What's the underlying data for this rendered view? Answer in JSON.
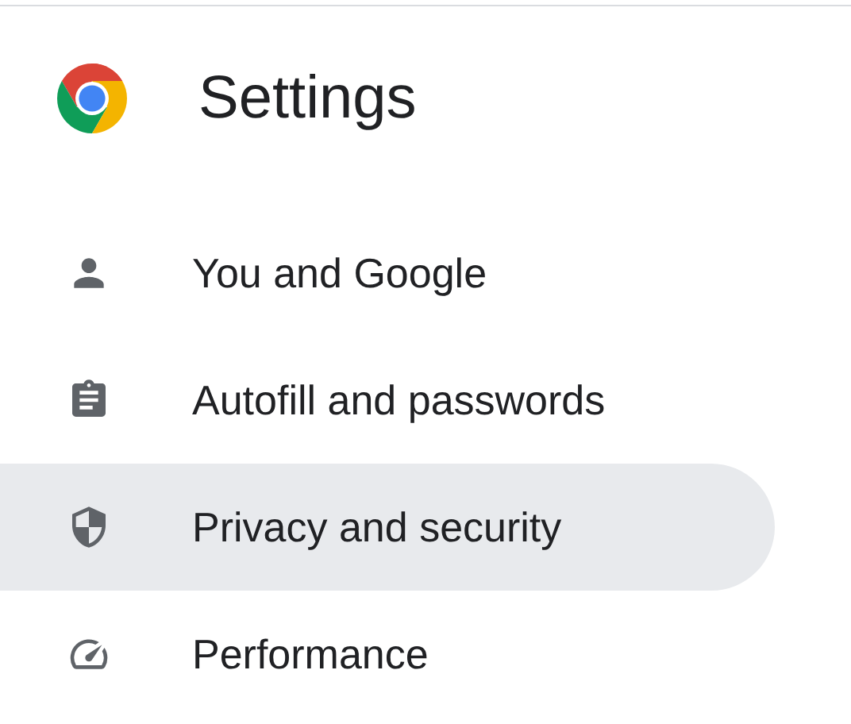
{
  "header": {
    "title": "Settings"
  },
  "menu": [
    {
      "label": "You and Google",
      "selected": false
    },
    {
      "label": "Autofill and passwords",
      "selected": false
    },
    {
      "label": "Privacy and security",
      "selected": true
    },
    {
      "label": "Performance",
      "selected": false
    }
  ]
}
